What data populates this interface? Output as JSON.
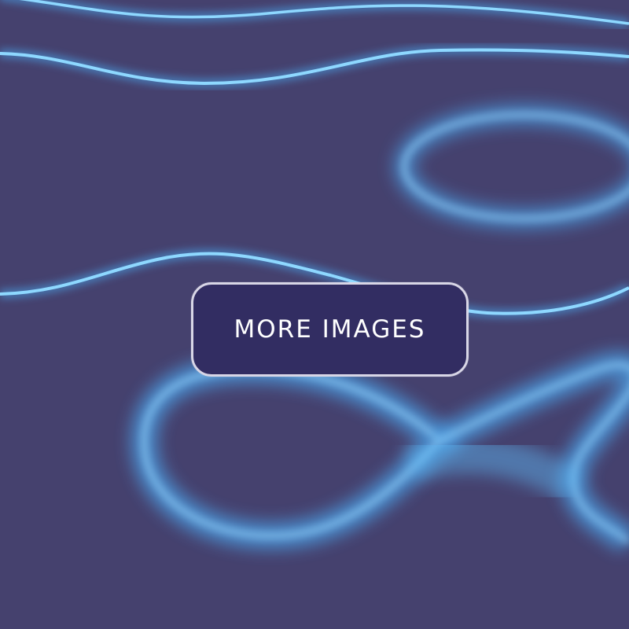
{
  "button": {
    "label": "MORE IMAGES"
  },
  "colors": {
    "background": "#45416e",
    "glow": "#6cc8ff",
    "glow_core": "#b9e9ff",
    "button_fill": "#322d62",
    "button_border": "#d8d6e6"
  }
}
